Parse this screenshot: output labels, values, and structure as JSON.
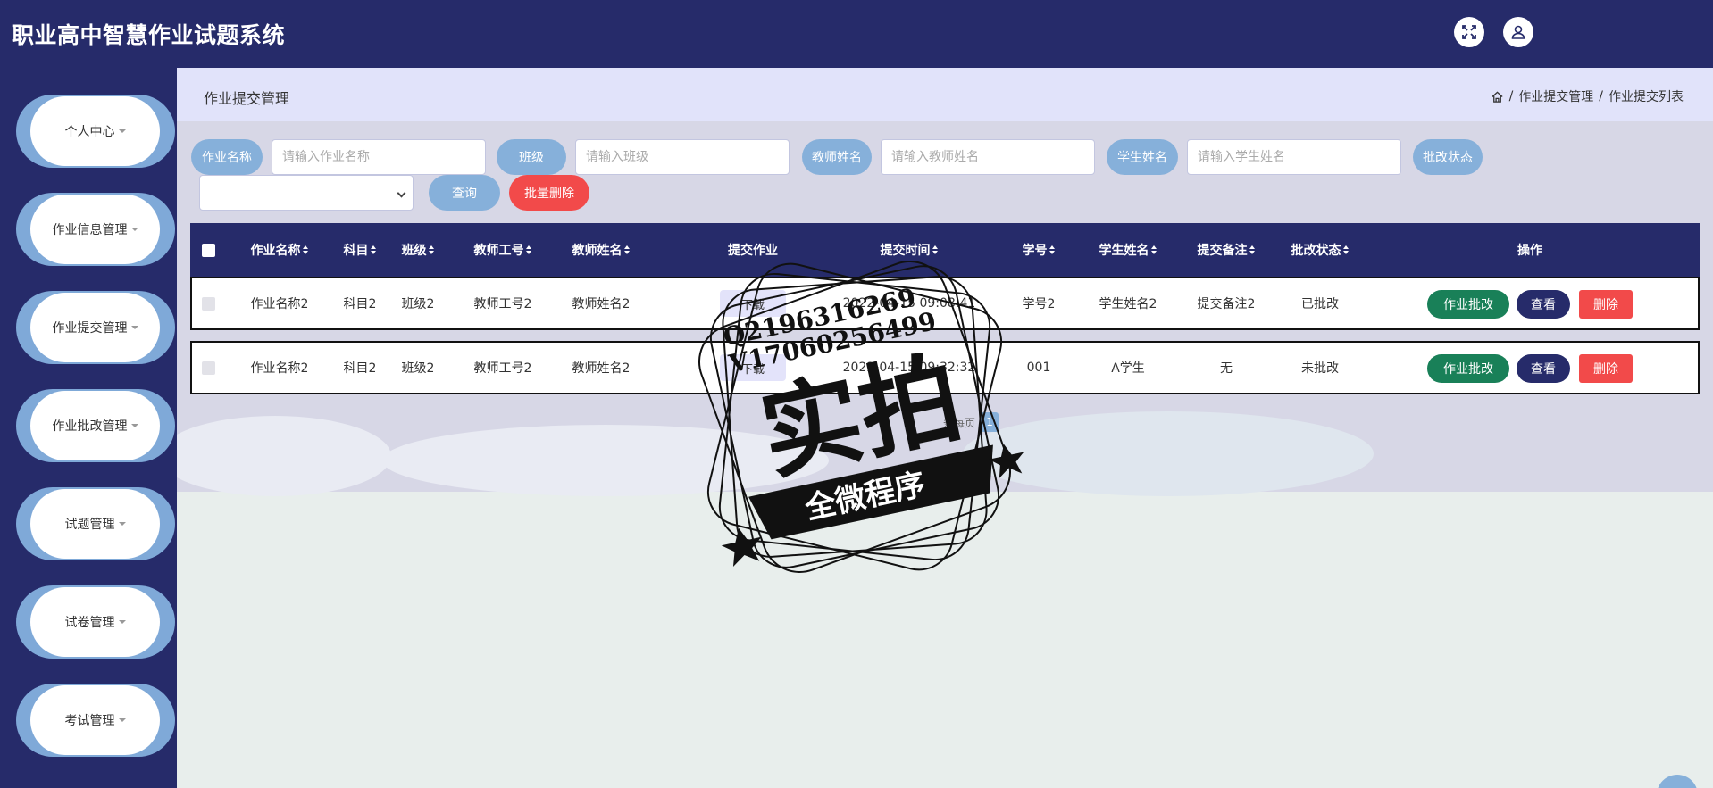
{
  "app": {
    "title": "职业高中智慧作业试题系统"
  },
  "header": {
    "fullscreen_icon": "expand-icon",
    "user_icon": "user-icon"
  },
  "sidebar": {
    "items": [
      {
        "label": "个人中心"
      },
      {
        "label": "作业信息管理"
      },
      {
        "label": "作业提交管理"
      },
      {
        "label": "作业批改管理"
      },
      {
        "label": "试题管理"
      },
      {
        "label": "试卷管理"
      },
      {
        "label": "考试管理"
      }
    ]
  },
  "page": {
    "title": "作业提交管理",
    "breadcrumb": [
      "作业提交管理",
      "作业提交列表"
    ],
    "breadcrumb_sep": "/"
  },
  "search": {
    "homework_name_label": "作业名称",
    "homework_name_placeholder": "请输入作业名称",
    "class_label": "班级",
    "class_placeholder": "请输入班级",
    "teacher_name_label": "教师姓名",
    "teacher_name_placeholder": "请输入教师姓名",
    "student_name_label": "学生姓名",
    "student_name_placeholder": "请输入学生姓名",
    "status_label": "批改状态",
    "status_selected": "",
    "query_label": "查询",
    "batch_delete_label": "批量删除"
  },
  "table": {
    "headers": {
      "name": "作业名称",
      "subject": "科目",
      "class": "班级",
      "teacher_no": "教师工号",
      "teacher_name": "教师姓名",
      "submit_file": "提交作业",
      "submit_time": "提交时间",
      "student_no": "学号",
      "student_name": "学生姓名",
      "remark": "提交备注",
      "status": "批改状态",
      "ops": "操作"
    },
    "rows": [
      {
        "name": "作业名称2",
        "subject": "科目2",
        "class": "班级2",
        "teacher_no": "教师工号2",
        "teacher_name": "教师姓名2",
        "download": "下载",
        "submit_time": "2022-04-15 09:08:41",
        "student_no": "学号2",
        "student_name": "学生姓名2",
        "remark": "提交备注2",
        "status": "已批改"
      },
      {
        "name": "作业名称2",
        "subject": "科目2",
        "class": "班级2",
        "teacher_no": "教师工号2",
        "teacher_name": "教师姓名2",
        "download": "下载",
        "submit_time": "2022-04-15 09:32:32",
        "student_no": "001",
        "student_name": "A学生",
        "remark": "无",
        "status": "未批改"
      }
    ],
    "actions": {
      "grade": "作业批改",
      "view": "查看",
      "delete": "删除"
    }
  },
  "pagination": {
    "per_page_text": "条每页",
    "current_page": "1"
  },
  "watermark": {
    "line1": "Q2196316269",
    "line2": "V17060256499",
    "main": "实拍",
    "ribbon": "全微程序"
  },
  "colors": {
    "navy": "#262b6a",
    "pill_blue": "#86b0da",
    "green": "#198058",
    "red": "#f24a4a"
  }
}
